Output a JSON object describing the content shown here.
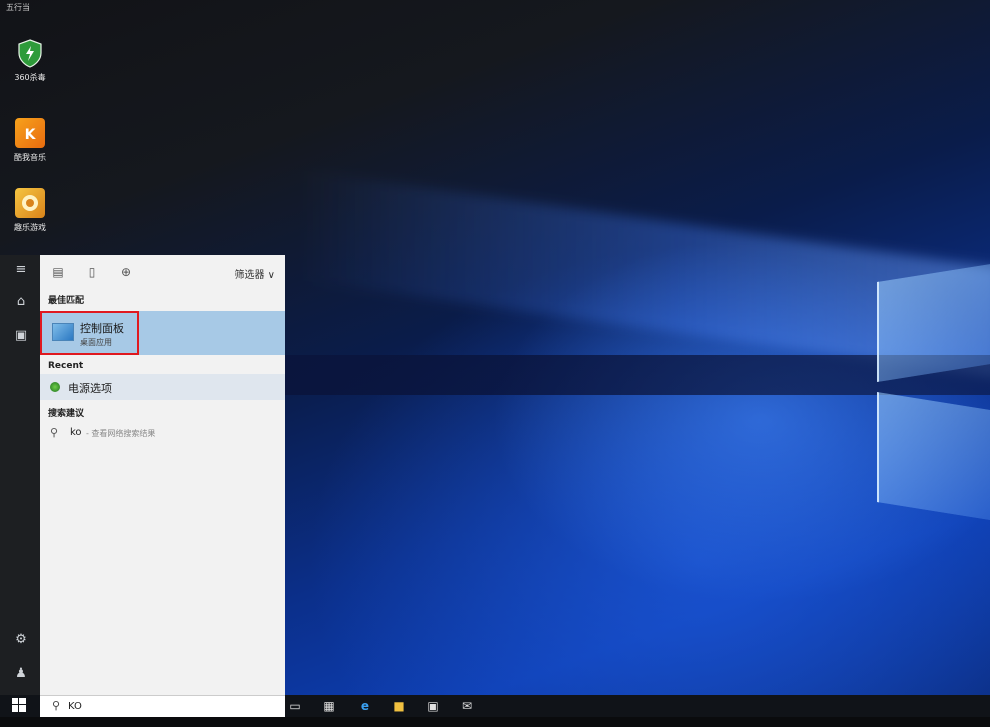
{
  "desktop": {
    "top_label": "五行当",
    "icons": [
      {
        "label": "360杀毒",
        "icon": "shield-icon"
      },
      {
        "label": "酷我音乐",
        "icon": "music-app-icon"
      },
      {
        "label": "趣乐游戏",
        "icon": "game-app-icon"
      }
    ]
  },
  "start_menu": {
    "rail": {
      "menu": "hamburger-icon",
      "home": "home-icon",
      "recent": "documents-icon",
      "settings": "gear-icon",
      "user": "user-icon"
    },
    "filter_label": "筛选器 ∨",
    "best_match_header": "最佳匹配",
    "best_match": {
      "name": "控制面板",
      "type": "桌面应用"
    },
    "recent_header": "Recent",
    "recent_items": [
      {
        "label": "电源选项"
      }
    ],
    "suggest_header": "搜索建议",
    "suggestions": [
      {
        "query": "ko",
        "hint": "- 查看网络搜索结果"
      }
    ]
  },
  "taskbar": {
    "search_value": "KO",
    "icons": [
      "task-view-icon",
      "app-icon",
      "edge-icon",
      "file-explorer-icon",
      "store-icon",
      "mail-icon"
    ]
  },
  "colors": {
    "highlight": "#a7c9e6",
    "annotation_box": "#e0191f",
    "panel_bg": "#f2f2f2"
  }
}
